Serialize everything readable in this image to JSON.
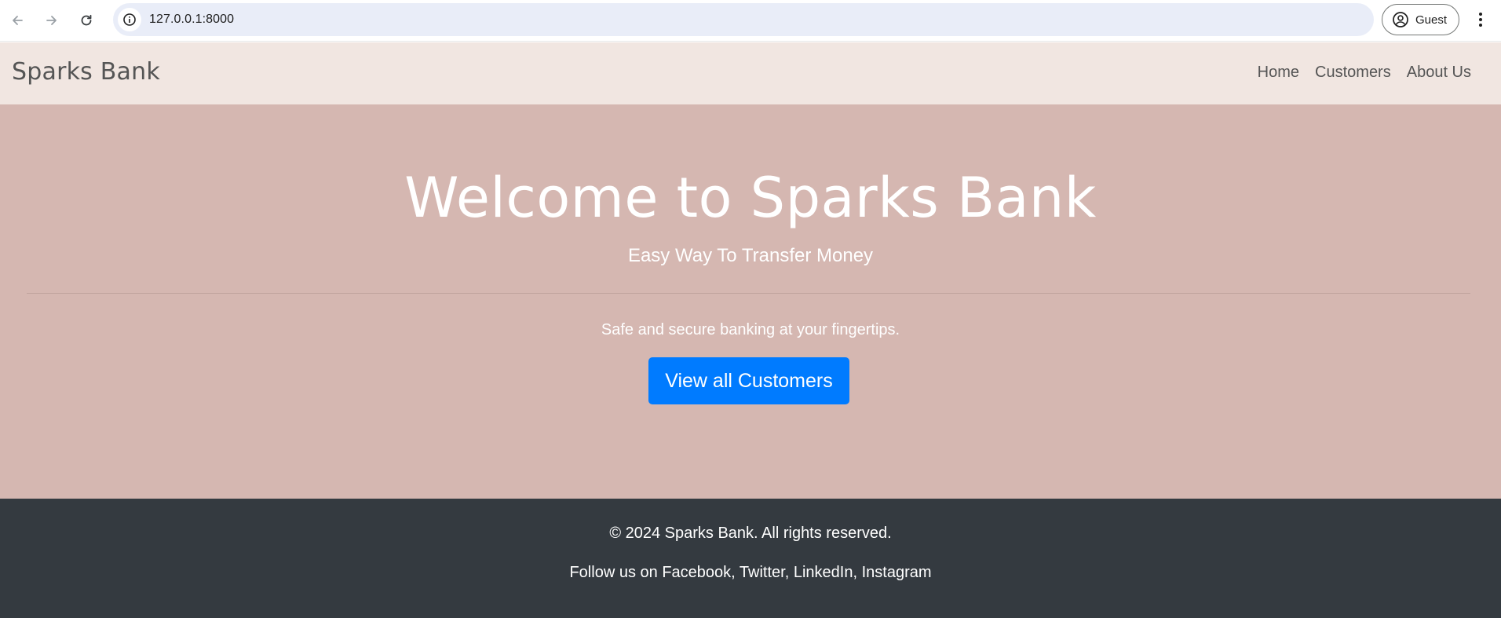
{
  "browser": {
    "url": "127.0.0.1:8000",
    "profile_label": "Guest"
  },
  "navbar": {
    "brand": "Sparks Bank",
    "links": [
      "Home",
      "Customers",
      "About Us"
    ]
  },
  "hero": {
    "title": "Welcome to Sparks Bank",
    "subtitle": "Easy Way To Transfer Money",
    "lead": "Safe and secure banking at your fingertips.",
    "cta_label": "View all Customers"
  },
  "footer": {
    "copyright": "© 2024 Sparks Bank. All rights reserved.",
    "follow_prefix": "Follow us on",
    "social": [
      "Facebook",
      "Twitter",
      "LinkedIn",
      "Instagram"
    ]
  },
  "colors": {
    "navbar_bg": "#f1e6e1",
    "hero_bg": "#d5b7b1",
    "button_primary": "#007bff",
    "footer_bg": "#343a40"
  }
}
